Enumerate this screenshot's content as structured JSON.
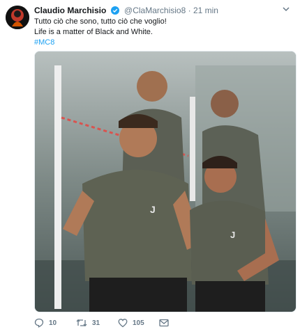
{
  "tweet": {
    "author_name": "Claudio Marchisio",
    "handle": "@ClaMarchisio8",
    "separator": "·",
    "time": "21 min",
    "text_lines": [
      "Tutto ciò che sono, tutto ciò che voglio!",
      "Life is a matter of Black and White."
    ],
    "hashtag": "#MC8",
    "media_description_icon": "photo",
    "replies": "10",
    "retweets": "31",
    "likes": "105"
  },
  "icons": {
    "verified": "verified-badge-icon",
    "menu": "chevron-down-icon",
    "reply": "reply-icon",
    "retweet": "retweet-icon",
    "like": "heart-icon",
    "message": "envelope-icon"
  },
  "colors": {
    "link": "#1da1f2",
    "muted": "#657786",
    "text": "#14171a",
    "verified": "#1da1f2"
  }
}
